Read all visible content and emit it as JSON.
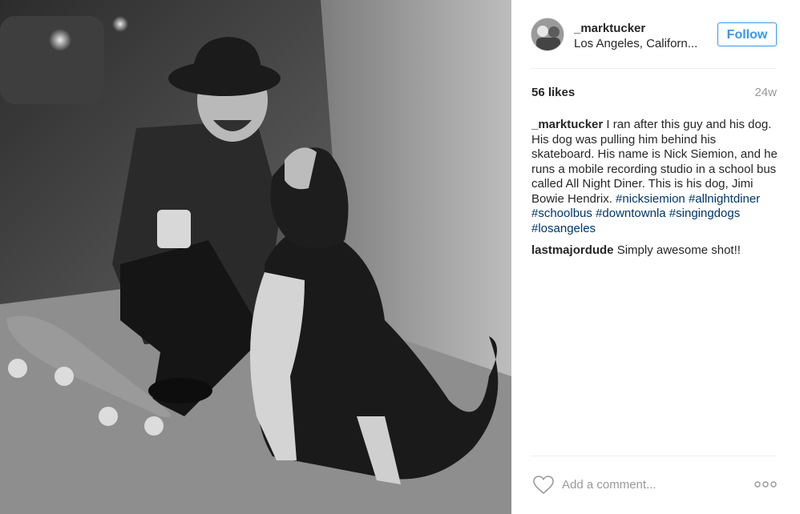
{
  "post": {
    "photo_icon": "post-photo",
    "author": {
      "username": "_marktucker",
      "location": "Los Angeles, Californ...",
      "avatar_icon": "avatar"
    },
    "follow_label": "Follow",
    "likes": "56 likes",
    "time_ago": "24w",
    "caption": {
      "username": "_marktucker",
      "text": " I ran after this guy and his dog. His dog was pulling him behind his skateboard. His name is Nick Siemion, and he runs a mobile recording studio in a school bus called All Night Diner. This is his dog, Jimi Bowie Hendrix. ",
      "hashtags": [
        "#nicksiemion",
        "#allnightdiner",
        "#schoolbus",
        "#downtownla",
        "#singingdogs",
        "#losangeles"
      ]
    },
    "comments": [
      {
        "username": "lastmajordude",
        "text": " Simply awesome shot!!"
      }
    ],
    "add_comment_placeholder": "Add a comment...",
    "like_icon": "heart-icon",
    "more_icon": "more-options-icon"
  },
  "colors": {
    "accent": "#3897f0",
    "hashtag": "#003569",
    "muted": "#999999",
    "text": "#262626"
  }
}
